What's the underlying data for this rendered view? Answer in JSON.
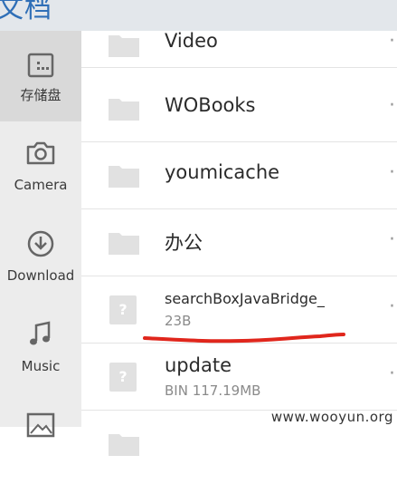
{
  "app": {
    "title": "文档"
  },
  "sidebar": {
    "items": [
      {
        "label": "存储盘",
        "icon": "storage-icon",
        "active": true
      },
      {
        "label": "Camera",
        "icon": "camera-icon",
        "active": false
      },
      {
        "label": "Download",
        "icon": "download-icon",
        "active": false
      },
      {
        "label": "Music",
        "icon": "music-icon",
        "active": false
      },
      {
        "label": "",
        "icon": "image-icon",
        "active": false
      }
    ]
  },
  "files": [
    {
      "name": "Video",
      "type": "folder",
      "meta": ""
    },
    {
      "name": "WOBooks",
      "type": "folder",
      "meta": ""
    },
    {
      "name": "youmicache",
      "type": "folder",
      "meta": ""
    },
    {
      "name": "办公",
      "type": "folder",
      "meta": ""
    },
    {
      "name": "searchBoxJavaBridge_",
      "type": "unknown-file",
      "meta": "23B"
    },
    {
      "name": "update",
      "type": "unknown-file",
      "meta": "BIN 117.19MB"
    }
  ],
  "unknown_file_glyph": "?",
  "annotation_color": "#e0261c",
  "watermark": "www.wooyun.org",
  "colors": {
    "accent": "#2f6fb7",
    "sidebar_bg": "#ececec",
    "sidebar_active": "#d9d9d9"
  }
}
